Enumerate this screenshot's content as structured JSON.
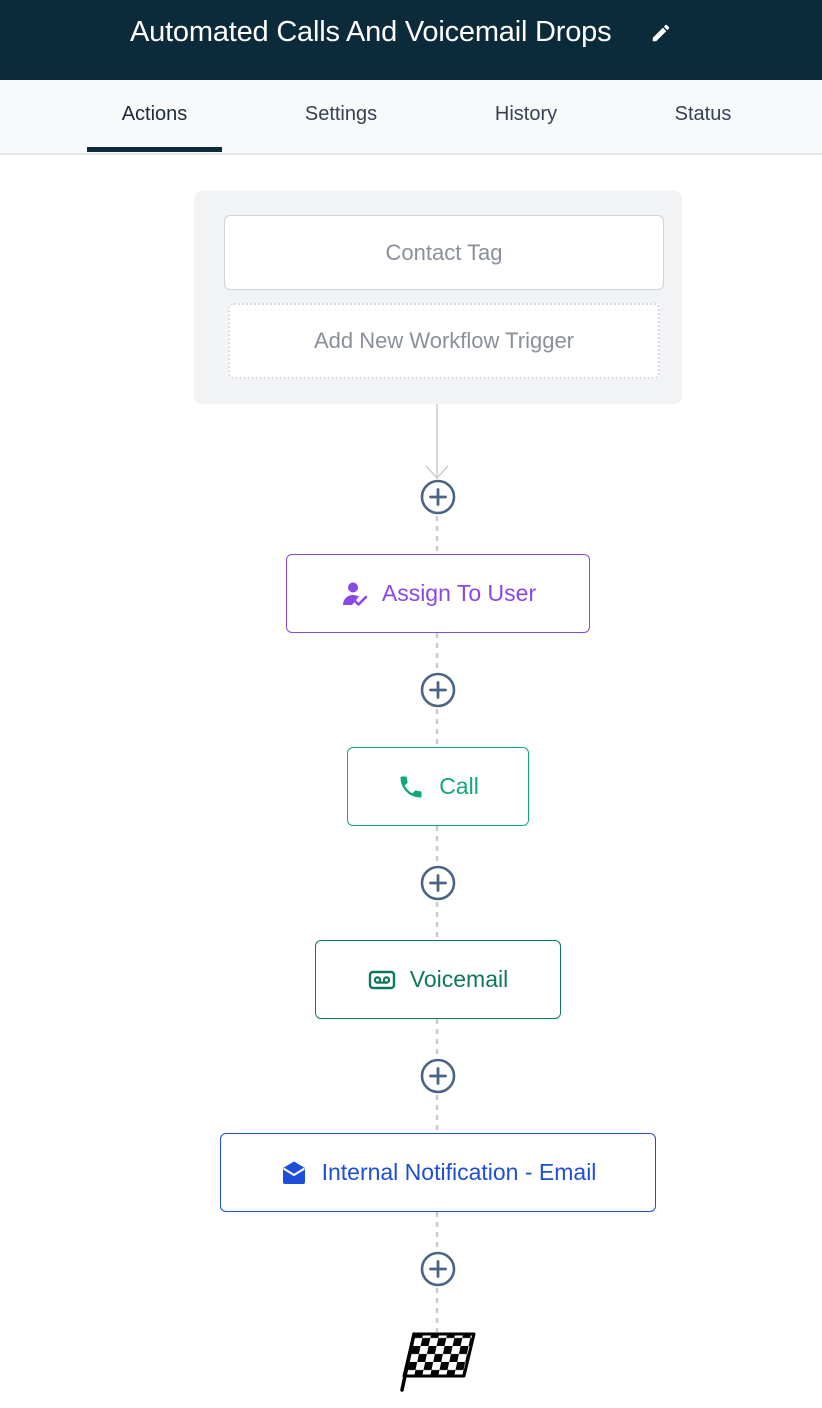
{
  "header": {
    "title": "Automated Calls And Voicemail Drops",
    "edit_icon": "pencil-icon"
  },
  "tabs": [
    {
      "label": "Actions",
      "active": true
    },
    {
      "label": "Settings",
      "active": false
    },
    {
      "label": "History",
      "active": false
    },
    {
      "label": "Status",
      "active": false
    }
  ],
  "triggers": {
    "items": [
      {
        "label": "Contact Tag"
      }
    ],
    "add_label": "Add New Workflow Trigger"
  },
  "actions": [
    {
      "label": "Assign To User",
      "icon": "assign-user-icon",
      "color": "#8b47e6"
    },
    {
      "label": "Call",
      "icon": "phone-icon",
      "color": "#12a97a"
    },
    {
      "label": "Voicemail",
      "icon": "voicemail-icon",
      "color": "#0f7a55"
    },
    {
      "label": "Internal Notification - Email",
      "icon": "envelope-icon",
      "color": "#1d4ed8"
    }
  ],
  "add_step_icon": "plus-circle-icon",
  "end_icon": "checkered-flag-icon",
  "colors": {
    "header_bg": "#0b2a3a",
    "plus_button": "#4b6483",
    "connector": "#c9cdd2"
  }
}
